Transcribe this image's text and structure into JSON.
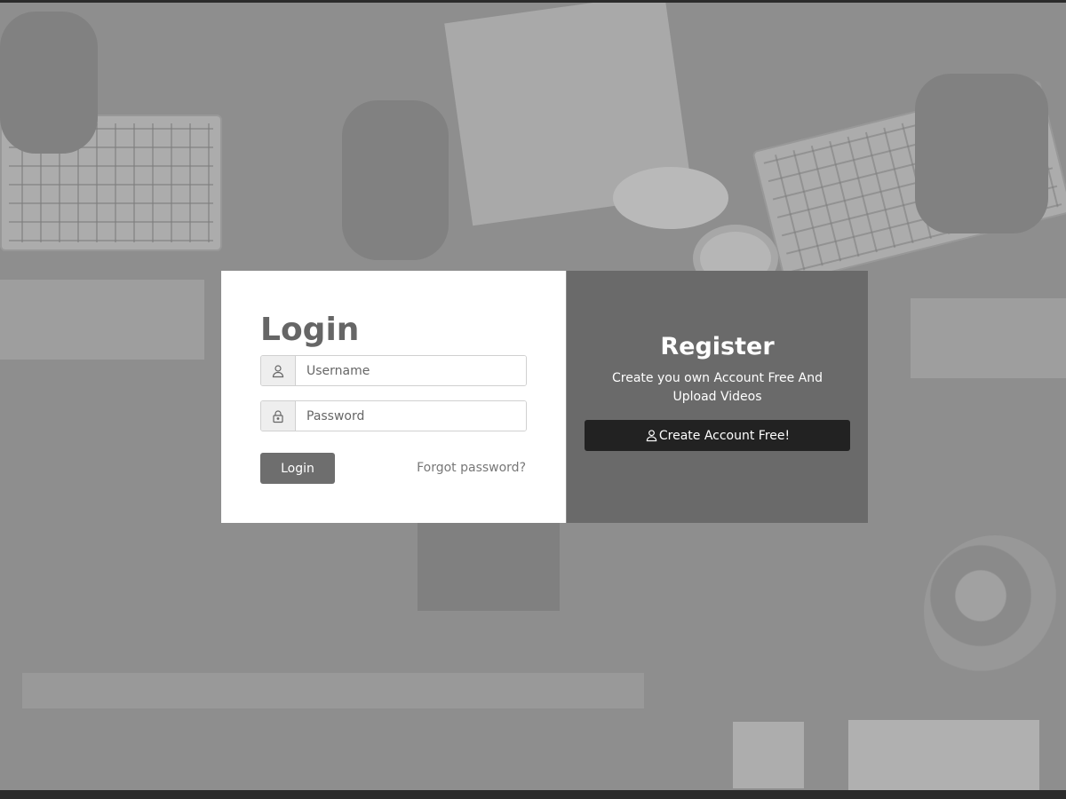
{
  "login": {
    "title": "Login",
    "username_placeholder": "Username",
    "password_placeholder": "Password",
    "login_button": "Login",
    "forgot_link": "Forgot password?",
    "username_icon": "user-icon",
    "password_icon": "lock-icon"
  },
  "register": {
    "title": "Register",
    "description": "Create you own Account Free And Upload Videos",
    "create_button": "Create Account Free!",
    "create_icon": "user-icon"
  },
  "colors": {
    "login_button": "#6e6e6e",
    "register_panel": "#6a6a6a",
    "create_button": "#222222"
  }
}
